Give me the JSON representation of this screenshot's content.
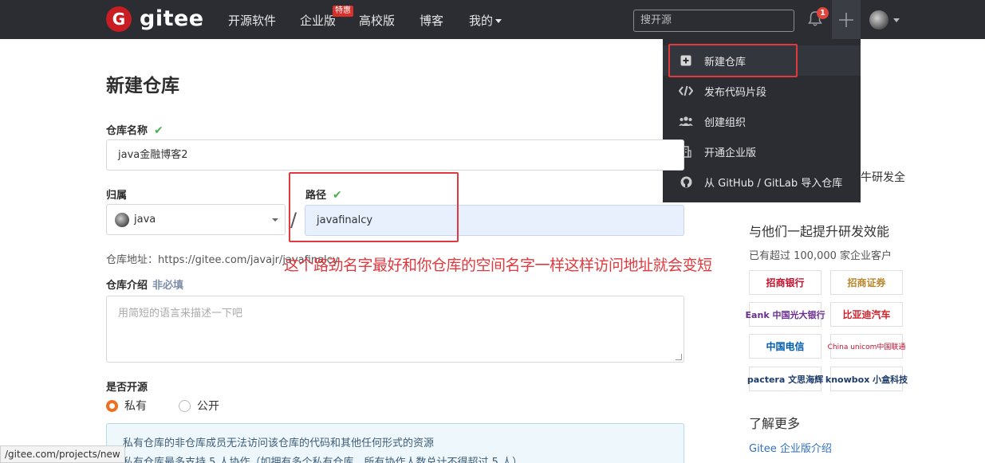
{
  "brand": {
    "logo_letter": "G",
    "name": "gitee"
  },
  "nav": {
    "links": [
      "开源软件",
      "企业版",
      "高校版",
      "博客",
      "我的"
    ],
    "badge": "特惠",
    "search_placeholder": "搜开源",
    "notification_count": "1"
  },
  "dropdown": {
    "items": [
      {
        "label": "新建仓库",
        "icon": "plus-square-icon"
      },
      {
        "label": "发布代码片段",
        "icon": "code-icon"
      },
      {
        "label": "创建组织",
        "icon": "users-icon"
      },
      {
        "label": "开通企业版",
        "icon": "building-icon"
      },
      {
        "label": "从 GitHub / GitLab 导入仓库",
        "icon": "github-icon"
      }
    ]
  },
  "form": {
    "title": "新建仓库",
    "repo_name_label": "仓库名称",
    "repo_name_value": "java金融博客2",
    "owner_label": "归属",
    "owner_value": "java",
    "path_label": "路径",
    "path_value": "javafinalcy",
    "repo_url": "仓库地址：https://gitee.com/javajr/javafinalcy",
    "desc_label": "仓库介绍",
    "desc_optional": "非必填",
    "desc_placeholder": "用简短的语言来描述一下吧",
    "open_label": "是否开源",
    "radio_private": "私有",
    "radio_public": "公开",
    "info_line1": "私有仓库的非仓库成员无法访问该仓库的代码和其他任何形式的资源",
    "info_line2": "私有仓库最多支持 5 人协作（如拥有多个私有仓库，所有协作人数总计不得超过 5 人）"
  },
  "annotation": "这个路劲名字最好和你仓库的空间名字一样这样访问地址就会变短",
  "status_bar": "/gitee.com/projects/new",
  "side": {
    "partial_text": "牛研发全",
    "heading": "与他们一起提升研发效能",
    "sub": "已有超过 100,000 家企业客户",
    "logos": [
      "招商银行",
      "招商证券",
      "Eank 中国光大银行",
      "比亚迪汽车",
      "中国电信",
      "China unicom中国联通",
      "pactera 文思海辉",
      "knowbox 小盒科技"
    ],
    "more": "了解更多",
    "link": "Gitee 企业版介绍"
  },
  "colors": {
    "nav_bg": "#2b2d33",
    "brand_red": "#c71d23",
    "highlight_red": "#e0393e",
    "radio_orange": "#ee6e22"
  }
}
